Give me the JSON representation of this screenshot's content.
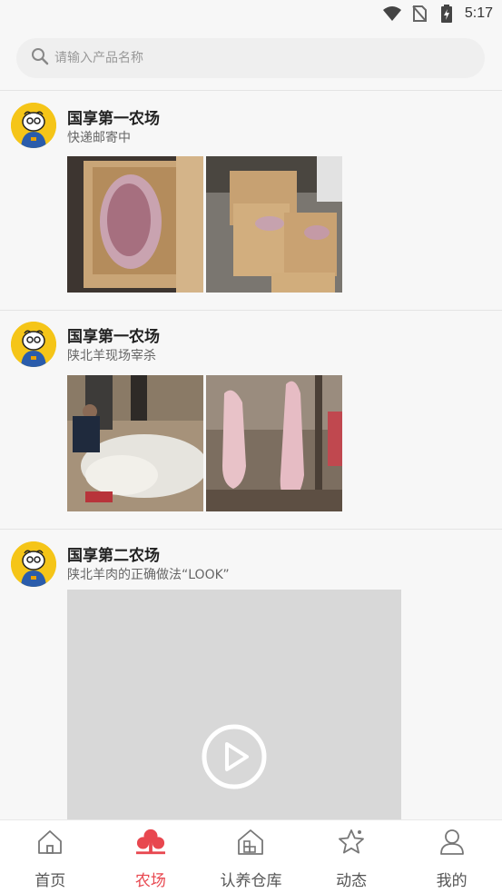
{
  "status": {
    "time": "5:17"
  },
  "search": {
    "placeholder": "请输入产品名称"
  },
  "posts": [
    {
      "author": "国享第一农场",
      "text": "快递邮寄中",
      "media": "photos"
    },
    {
      "author": "国享第一农场",
      "text": "陕北羊现场宰杀",
      "media": "photos"
    },
    {
      "author": "国享第二农场",
      "text": "陕北羊肉的正确做法“LOOK”",
      "media": "video"
    }
  ],
  "tabs": [
    {
      "label": "首页",
      "icon": "home-icon",
      "active": false
    },
    {
      "label": "农场",
      "icon": "farm-trees-icon",
      "active": true
    },
    {
      "label": "认养仓库",
      "icon": "warehouse-icon",
      "active": false
    },
    {
      "label": "动态",
      "icon": "star-icon",
      "active": false
    },
    {
      "label": "我的",
      "icon": "user-icon",
      "active": false
    }
  ],
  "colors": {
    "accent": "#e8474f",
    "background": "#f7f7f7",
    "tab_inactive": "#555555"
  }
}
